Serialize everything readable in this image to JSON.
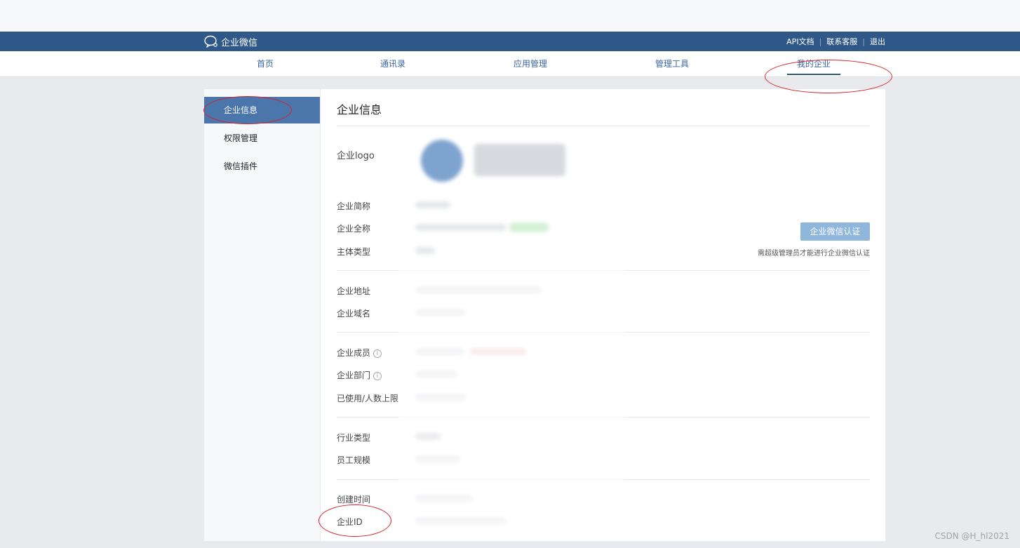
{
  "brand": {
    "name": "企业微信"
  },
  "top_links": [
    "API文档",
    "联系客服",
    "退出"
  ],
  "nav": {
    "items": [
      "首页",
      "通讯录",
      "应用管理",
      "管理工具",
      "我的企业"
    ],
    "active_index": 4
  },
  "sidebar": {
    "items": [
      "企业信息",
      "权限管理",
      "微信插件"
    ],
    "active_index": 0
  },
  "content": {
    "title": "企业信息",
    "labels": {
      "logo": "企业logo",
      "short_name": "企业简称",
      "full_name": "企业全称",
      "entity_type": "主体类型",
      "address": "企业地址",
      "domain": "企业域名",
      "members": "企业成员",
      "departments": "企业部门",
      "usage": "已使用/人数上限",
      "industry": "行业类型",
      "staff_size": "员工规模",
      "created": "创建时间",
      "corp_id": "企业ID"
    },
    "certify_button": "企业微信认证",
    "certify_note": "需超级管理员才能进行企业微信认证"
  },
  "watermark": "CSDN @H_hl2021",
  "colors": {
    "brand_bar": "#2f5787",
    "active_sidebar": "#4a76ac",
    "annotation": "#d4232a",
    "certify_button": "#90b6dc"
  }
}
